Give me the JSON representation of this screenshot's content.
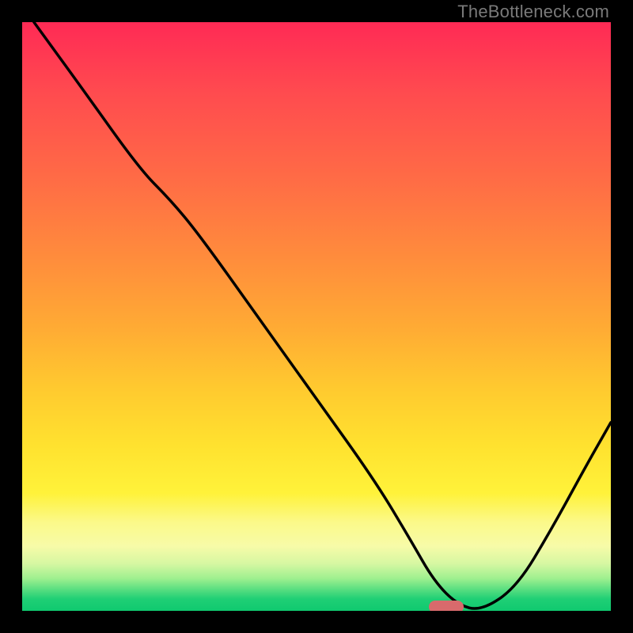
{
  "watermark": "TheBottleneck.com",
  "marker": {
    "x_pct": 72,
    "y_pct": 100
  },
  "chart_data": {
    "type": "line",
    "title": "",
    "xlabel": "",
    "ylabel": "",
    "xlim": [
      0,
      100
    ],
    "ylim": [
      0,
      100
    ],
    "grid": false,
    "legend": false,
    "series": [
      {
        "name": "curve",
        "x": [
          2,
          10,
          20,
          25,
          30,
          40,
          50,
          60,
          66,
          70,
          74,
          78,
          84,
          90,
          96,
          100
        ],
        "y": [
          100,
          89,
          75,
          70,
          64,
          50,
          36,
          22,
          12,
          5,
          1,
          0,
          4,
          14,
          25,
          32
        ]
      }
    ],
    "annotations": [
      {
        "kind": "pill-marker",
        "x": 72,
        "y": 0,
        "color": "#d86a6c"
      }
    ],
    "background_gradient": {
      "orientation": "vertical",
      "stops": [
        {
          "pos": 0.0,
          "color": "#ff2a55"
        },
        {
          "pos": 0.4,
          "color": "#ff8c3c"
        },
        {
          "pos": 0.72,
          "color": "#ffe22f"
        },
        {
          "pos": 0.88,
          "color": "#f7fba8"
        },
        {
          "pos": 1.0,
          "color": "#10c96f"
        }
      ]
    }
  }
}
